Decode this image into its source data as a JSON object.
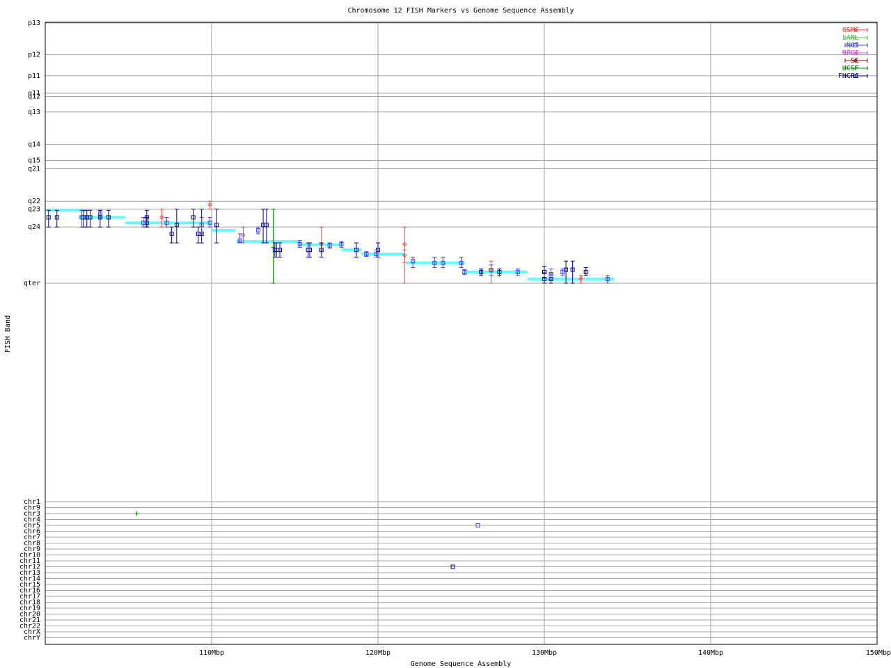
{
  "chart_data": {
    "type": "scatter",
    "title": "Chromosome 12 FISH Markers vs Genome Sequence Assembly",
    "xlabel": "Genome Sequence Assembly",
    "ylabel": "FISH Band",
    "xlim": [
      100,
      150
    ],
    "x_unit": "Mbp",
    "x_ticks": [
      {
        "value": 110,
        "label": "110Mbp"
      },
      {
        "value": 120,
        "label": "120Mbp"
      },
      {
        "value": 130,
        "label": "130Mbp"
      },
      {
        "value": 140,
        "label": "140Mbp"
      },
      {
        "value": 150,
        "label": "150Mbp"
      }
    ],
    "band_ticks": [
      {
        "label": "p13",
        "pos": 0.0
      },
      {
        "label": "p12",
        "pos": 0.122
      },
      {
        "label": "p11",
        "pos": 0.203
      },
      {
        "label": "q11",
        "pos": 0.27
      },
      {
        "label": "q12",
        "pos": 0.282
      },
      {
        "label": "q13",
        "pos": 0.342
      },
      {
        "label": "q14",
        "pos": 0.467
      },
      {
        "label": "q15",
        "pos": 0.528
      },
      {
        "label": "q21",
        "pos": 0.56
      },
      {
        "label": "q22",
        "pos": 0.685
      },
      {
        "label": "q23",
        "pos": 0.715
      },
      {
        "label": "q24",
        "pos": 0.784
      },
      {
        "label": "qter",
        "pos": 1.0
      }
    ],
    "chr_ticks": [
      "chr1",
      "chr9",
      "chr3",
      "chr4",
      "chr5",
      "chr6",
      "chr7",
      "chr8",
      "chr9",
      "chr10",
      "chr11",
      "chr12",
      "chr13",
      "chr14",
      "chr15",
      "chr16",
      "chr17",
      "chr18",
      "chr19",
      "chr20",
      "chr21",
      "chr22",
      "chrX",
      "chrY"
    ],
    "grid": true,
    "legend_position": "top-right",
    "legend": [
      {
        "name": "CSMC",
        "color": "#ff4040",
        "marker": "diamond"
      },
      {
        "name": "LANL",
        "color": "#40c040",
        "marker": "plus"
      },
      {
        "name": "NCI",
        "color": "#4040ff",
        "marker": "square"
      },
      {
        "name": "RPCI",
        "color": "#e040e0",
        "marker": "x"
      },
      {
        "name": "SC",
        "color": "#a00000",
        "marker": "diamond"
      },
      {
        "name": "UCSF",
        "color": "#008000",
        "marker": "plus"
      },
      {
        "name": "FHCRC",
        "color": "#000090",
        "marker": "square"
      }
    ],
    "assembly_color": "#66ffff",
    "assembly_segments": [
      {
        "x1": 100.0,
        "x2": 102.4,
        "band": 0.72
      },
      {
        "x1": 102.0,
        "x2": 104.8,
        "band": 0.747
      },
      {
        "x1": 104.8,
        "x2": 110.0,
        "band": 0.768
      },
      {
        "x1": 110.0,
        "x2": 111.4,
        "band": 0.797
      },
      {
        "x1": 111.5,
        "x2": 115.3,
        "band": 0.84
      },
      {
        "x1": 115.3,
        "x2": 117.8,
        "band": 0.852
      },
      {
        "x1": 117.8,
        "x2": 119.0,
        "band": 0.872
      },
      {
        "x1": 119.0,
        "x2": 121.6,
        "band": 0.888
      },
      {
        "x1": 121.7,
        "x2": 125.2,
        "band": 0.922
      },
      {
        "x1": 125.2,
        "x2": 129.0,
        "band": 0.957
      },
      {
        "x1": 129.0,
        "x2": 134.2,
        "band": 0.984
      }
    ],
    "markers": [
      {
        "lab": "FHCRC",
        "x": 100.2,
        "band": 0.747,
        "lo": 0.72,
        "hi": 0.784
      },
      {
        "lab": "FHCRC",
        "x": 100.7,
        "band": 0.747,
        "lo": 0.72,
        "hi": 0.784
      },
      {
        "lab": "NCI",
        "x": 102.2,
        "band": 0.747,
        "lo": 0.72,
        "hi": 0.784
      },
      {
        "lab": "FHCRC",
        "x": 102.3,
        "band": 0.747,
        "lo": 0.72,
        "hi": 0.784
      },
      {
        "lab": "FHCRC",
        "x": 102.5,
        "band": 0.747,
        "lo": 0.72,
        "hi": 0.784
      },
      {
        "lab": "FHCRC",
        "x": 102.7,
        "band": 0.747,
        "lo": 0.72,
        "hi": 0.784
      },
      {
        "lab": "NCI",
        "x": 103.3,
        "band": 0.733,
        "lo": 0.72,
        "hi": 0.747
      },
      {
        "lab": "FHCRC",
        "x": 103.3,
        "band": 0.747,
        "lo": 0.72,
        "hi": 0.784
      },
      {
        "lab": "FHCRC",
        "x": 103.8,
        "band": 0.747,
        "lo": 0.72,
        "hi": 0.784
      },
      {
        "lab": "NCI",
        "x": 105.9,
        "band": 0.768,
        "lo": 0.747,
        "hi": 0.784
      },
      {
        "lab": "FHCRC",
        "x": 106.1,
        "band": 0.747,
        "lo": 0.72,
        "hi": 0.784
      },
      {
        "lab": "FHCRC",
        "x": 106.1,
        "band": 0.768,
        "lo": 0.747,
        "hi": 0.784
      },
      {
        "lab": "CSMC",
        "x": 107.0,
        "band": 0.747,
        "lo": 0.715,
        "hi": 0.784
      },
      {
        "lab": "NCI",
        "x": 107.3,
        "band": 0.768,
        "lo": 0.747,
        "hi": 0.784
      },
      {
        "lab": "FHCRC",
        "x": 107.6,
        "band": 0.81,
        "lo": 0.784,
        "hi": 0.845
      },
      {
        "lab": "FHCRC",
        "x": 107.9,
        "band": 0.776,
        "lo": 0.715,
        "hi": 0.845
      },
      {
        "lab": "FHCRC",
        "x": 108.9,
        "band": 0.747,
        "lo": 0.715,
        "hi": 0.784
      },
      {
        "lab": "FHCRC",
        "x": 109.2,
        "band": 0.81,
        "lo": 0.784,
        "hi": 0.845
      },
      {
        "lab": "FHCRC",
        "x": 109.4,
        "band": 0.81,
        "lo": 0.715,
        "hi": 0.845
      },
      {
        "lab": "NCI",
        "x": 109.4,
        "band": 0.776,
        "lo": 0.747,
        "hi": 0.81
      },
      {
        "lab": "CSMC",
        "x": 109.9,
        "band": 0.698,
        "lo": 0.685,
        "hi": 0.715
      },
      {
        "lab": "NCI",
        "x": 109.9,
        "band": 0.768,
        "lo": 0.747,
        "hi": 0.784
      },
      {
        "lab": "FHCRC",
        "x": 110.3,
        "band": 0.776,
        "lo": 0.715,
        "hi": 0.845
      },
      {
        "lab": "CSMC",
        "x": 111.9,
        "band": 0.815,
        "lo": 0.784,
        "hi": 0.845
      },
      {
        "lab": "NCI",
        "x": 111.7,
        "band": 0.836,
        "lo": 0.81,
        "hi": 0.845
      },
      {
        "lab": "NCI",
        "x": 112.8,
        "band": 0.797,
        "lo": 0.784,
        "hi": 0.81
      },
      {
        "lab": "FHCRC",
        "x": 113.1,
        "band": 0.776,
        "lo": 0.715,
        "hi": 0.845
      },
      {
        "lab": "FHCRC",
        "x": 113.3,
        "band": 0.776,
        "lo": 0.715,
        "hi": 0.845
      },
      {
        "lab": "UCSF",
        "x": 113.7,
        "band": 0.862,
        "lo": 0.715,
        "hi": 1.0
      },
      {
        "lab": "FHCRC",
        "x": 113.8,
        "band": 0.872,
        "lo": 0.845,
        "hi": 0.9
      },
      {
        "lab": "FHCRC",
        "x": 113.9,
        "band": 0.872,
        "lo": 0.845,
        "hi": 0.9
      },
      {
        "lab": "FHCRC",
        "x": 114.1,
        "band": 0.872,
        "lo": 0.845,
        "hi": 0.9
      },
      {
        "lab": "NCI",
        "x": 115.3,
        "band": 0.85,
        "lo": 0.836,
        "hi": 0.862
      },
      {
        "lab": "FHCRC",
        "x": 115.8,
        "band": 0.872,
        "lo": 0.845,
        "hi": 0.9
      },
      {
        "lab": "FHCRC",
        "x": 115.9,
        "band": 0.872,
        "lo": 0.845,
        "hi": 0.9
      },
      {
        "lab": "CSMC",
        "x": 116.6,
        "band": 0.85,
        "lo": 0.784,
        "hi": 0.872
      },
      {
        "lab": "FHCRC",
        "x": 116.6,
        "band": 0.872,
        "lo": 0.845,
        "hi": 0.9
      },
      {
        "lab": "NCI",
        "x": 117.1,
        "band": 0.855,
        "lo": 0.845,
        "hi": 0.865
      },
      {
        "lab": "NCI",
        "x": 117.8,
        "band": 0.85,
        "lo": 0.84,
        "hi": 0.862
      },
      {
        "lab": "FHCRC",
        "x": 118.7,
        "band": 0.872,
        "lo": 0.845,
        "hi": 0.9
      },
      {
        "lab": "NCI",
        "x": 119.3,
        "band": 0.888,
        "lo": 0.879,
        "hi": 0.897
      },
      {
        "lab": "FHCRC",
        "x": 120.0,
        "band": 0.872,
        "lo": 0.845,
        "hi": 0.9
      },
      {
        "lab": "NCI",
        "x": 119.9,
        "band": 0.888,
        "lo": 0.872,
        "hi": 0.9
      },
      {
        "lab": "CSMC",
        "x": 121.6,
        "band": 0.85,
        "lo": 0.784,
        "hi": 1.0
      },
      {
        "lab": "CSMC",
        "x": 121.6,
        "band": 0.893,
        "lo": 0.872,
        "hi": 0.92
      },
      {
        "lab": "NCI",
        "x": 122.1,
        "band": 0.915,
        "lo": 0.9,
        "hi": 0.94
      },
      {
        "lab": "NCI",
        "x": 123.4,
        "band": 0.922,
        "lo": 0.9,
        "hi": 0.94
      },
      {
        "lab": "NCI",
        "x": 123.9,
        "band": 0.922,
        "lo": 0.9,
        "hi": 0.94
      },
      {
        "lab": "NCI",
        "x": 125.0,
        "band": 0.922,
        "lo": 0.9,
        "hi": 0.94
      },
      {
        "lab": "NCI",
        "x": 125.2,
        "band": 0.957,
        "lo": 0.948,
        "hi": 0.966
      },
      {
        "lab": "FHCRC",
        "x": 126.2,
        "band": 0.957,
        "lo": 0.945,
        "hi": 0.97
      },
      {
        "lab": "CSMC",
        "x": 126.8,
        "band": 0.948,
        "lo": 0.915,
        "hi": 1.0
      },
      {
        "lab": "NCI",
        "x": 126.8,
        "band": 0.95,
        "lo": 0.93,
        "hi": 0.97
      },
      {
        "lab": "FHCRC",
        "x": 127.3,
        "band": 0.957,
        "lo": 0.945,
        "hi": 0.97
      },
      {
        "lab": "NCI",
        "x": 128.4,
        "band": 0.957,
        "lo": 0.945,
        "hi": 0.97
      },
      {
        "lab": "FHCRC",
        "x": 130.0,
        "band": 0.957,
        "lo": 0.935,
        "hi": 0.98
      },
      {
        "lab": "FHCRC",
        "x": 130.0,
        "band": 0.984,
        "lo": 0.96,
        "hi": 1.0
      },
      {
        "lab": "FHCRC",
        "x": 130.4,
        "band": 0.984,
        "lo": 0.965,
        "hi": 1.0
      },
      {
        "lab": "NCI",
        "x": 130.4,
        "band": 0.965,
        "lo": 0.945,
        "hi": 0.985
      },
      {
        "lab": "NCI",
        "x": 131.1,
        "band": 0.957,
        "lo": 0.945,
        "hi": 0.97
      },
      {
        "lab": "FHCRC",
        "x": 131.3,
        "band": 0.948,
        "lo": 0.915,
        "hi": 1.0
      },
      {
        "lab": "FHCRC",
        "x": 131.7,
        "band": 0.948,
        "lo": 0.915,
        "hi": 1.0
      },
      {
        "lab": "CSMC",
        "x": 132.2,
        "band": 0.984,
        "lo": 0.97,
        "hi": 1.0
      },
      {
        "lab": "FHCRC",
        "x": 132.5,
        "band": 0.957,
        "lo": 0.94,
        "hi": 0.97
      },
      {
        "lab": "NCI",
        "x": 133.8,
        "band": 0.984,
        "lo": 0.97,
        "hi": 1.0
      }
    ],
    "other_chromosome_hits": [
      {
        "lab": "UCSF",
        "x": 105.5,
        "chr_index": 2
      },
      {
        "lab": "NCI",
        "x": 126.0,
        "chr_index": 4
      },
      {
        "lab": "FHCRC",
        "x": 124.5,
        "chr_index": 11
      }
    ]
  }
}
